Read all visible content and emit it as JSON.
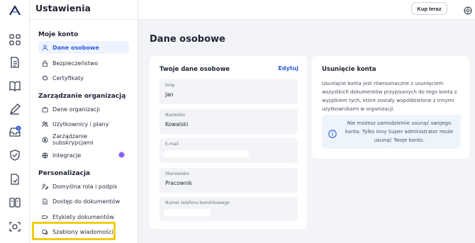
{
  "rail": {
    "logo": "brand-logo",
    "icons": [
      "grid-icon",
      "document-icon",
      "book-icon",
      "pen-icon",
      "inbox-icon",
      "shield-check-icon",
      "file-check-icon",
      "columns-icon",
      "scan-face-icon"
    ],
    "inbox_badge": "1"
  },
  "sidebar": {
    "title": "Ustawienia",
    "sections": [
      {
        "label": "Moje konto",
        "items": [
          {
            "label": "Dane osobowe",
            "icon": "user-icon",
            "active": true
          },
          {
            "label": "Bezpieczeństwo",
            "icon": "lock-icon"
          },
          {
            "label": "Certyfikaty",
            "icon": "certificate-icon"
          }
        ]
      },
      {
        "label": "Zarządzanie organizacją",
        "items": [
          {
            "label": "Dane organizacji",
            "icon": "briefcase-icon"
          },
          {
            "label": "Użytkownicy i plany",
            "icon": "users-icon"
          },
          {
            "label": "Zarządzanie subskrypcjami",
            "icon": "subscription-icon"
          },
          {
            "label": "Integracje",
            "icon": "integration-icon",
            "badge": "purple-dot"
          }
        ]
      },
      {
        "label": "Personalizacja",
        "items": [
          {
            "label": "Domyślna rola i podpis",
            "icon": "user-pen-icon"
          },
          {
            "label": "Dostęp do dokumentów",
            "icon": "document-lock-icon"
          },
          {
            "label": "Etykiety dokumentów",
            "icon": "tag-icon"
          },
          {
            "label": "Szablony wiadomości",
            "icon": "message-template-icon",
            "highlighted": true
          }
        ]
      }
    ]
  },
  "topbar": {
    "buy_button": "Kup teraz",
    "settings_icon": "settings-icon"
  },
  "main": {
    "page_title": "Dane osobowe",
    "personal_card": {
      "title": "Twoje dane osobowe",
      "edit_label": "Edytuj",
      "fields": [
        {
          "label": "Imię",
          "value": "Jan"
        },
        {
          "label": "Nazwisko",
          "value": "Kowalski"
        },
        {
          "label": "E-mail",
          "value": ""
        },
        {
          "label": "Stanowisko",
          "value": "Pracownik"
        },
        {
          "label": "Numer telefonu komórkowego",
          "value": ""
        }
      ]
    },
    "delete_card": {
      "title": "Usunięcie konta",
      "description": "Usunięcie konta jest równoznaczne z usunięciem wszystkich dokumentów przypisanych do tego konta z wyjątkiem tych, które zostały współdzielone z innymi użytkownikami w organizacji.",
      "notice": "Nie możesz samodzielnie usunąć swojego konta. Tylko inny Super administrator może usunąć Twoje konto.",
      "notice_icon": "info-icon"
    }
  },
  "colors": {
    "accent": "#2f5bd6",
    "active_bg": "#eef4ff",
    "highlight": "#f2cc14",
    "badge": "#8b5cf6",
    "page_bg": "#f3f4f7"
  }
}
